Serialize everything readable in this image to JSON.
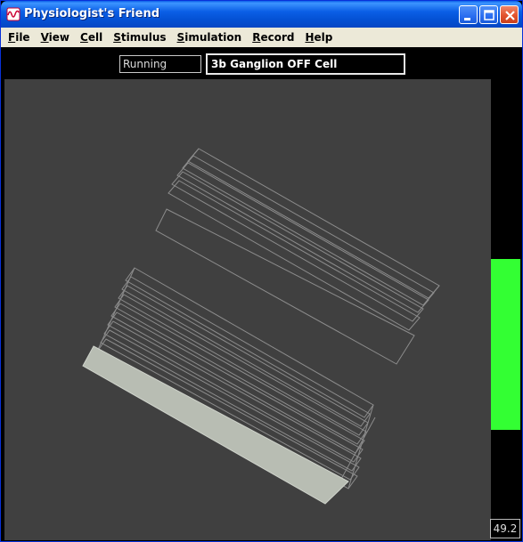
{
  "window": {
    "title": "Physiologist's Friend",
    "app_icon": "sine-wave-icon",
    "controls": [
      "minimize-icon",
      "maximize-icon",
      "close-icon"
    ]
  },
  "menu": {
    "items": [
      {
        "label": "File",
        "mnemonic": "F"
      },
      {
        "label": "View",
        "mnemonic": "V"
      },
      {
        "label": "Cell",
        "mnemonic": "C"
      },
      {
        "label": "Stimulus",
        "mnemonic": "S"
      },
      {
        "label": "Simulation",
        "mnemonic": "S"
      },
      {
        "label": "Record",
        "mnemonic": "R"
      },
      {
        "label": "Help",
        "mnemonic": "H"
      }
    ]
  },
  "status": {
    "state": "Running",
    "cell_name": "3b Ganglion OFF Cell"
  },
  "meter": {
    "value_text": "49.2",
    "level_top_fraction": 0.39,
    "level_bottom_fraction": 0.76,
    "color": "#33ff33"
  },
  "colors": {
    "canvas_bg": "#404040",
    "wireframe": "#8c8c8c",
    "solid_bar": "#b8bdb3"
  }
}
